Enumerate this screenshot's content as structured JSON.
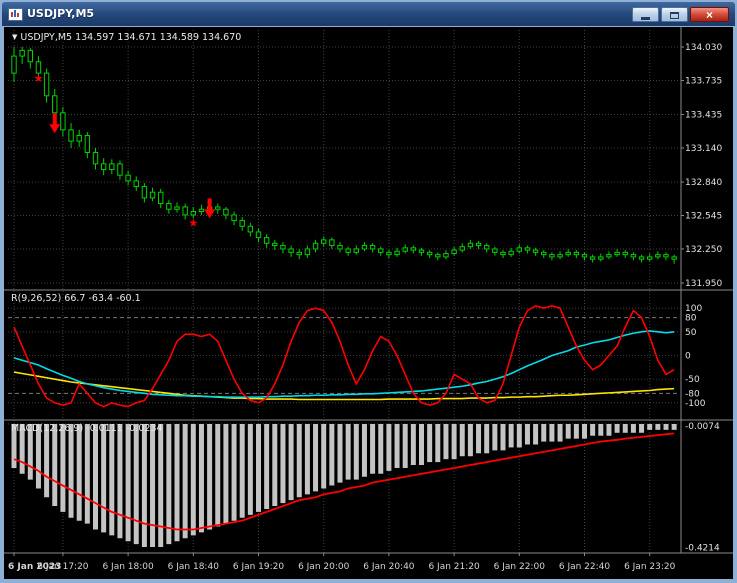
{
  "window": {
    "title": "USDJPY,M5",
    "close_glyph": "×"
  },
  "chart_header": {
    "dropdown_icon": "▼",
    "text": "USDJPY,M5 134.597 134.671 134.589 134.670"
  },
  "colors": {
    "background": "#000000",
    "window_border": "#8fafd4",
    "bull_candle": "#00d200",
    "grid": "#3f3f3f",
    "separator": "#8a8a8a",
    "scale_text": "#e0e0e0",
    "macd_hist": "#c4c4c4",
    "macd_signal": "#ff0000",
    "signal_marks": "#ff0000"
  },
  "chart_data": {
    "type": "candlestick",
    "symbol": "USDJPY",
    "timeframe": "M5",
    "star_glyph": "★",
    "price_axis": {
      "min": 131.95,
      "max": 134.03,
      "labels": [
        "134.030",
        "133.735",
        "133.435",
        "133.140",
        "132.840",
        "132.545",
        "132.250",
        "131.950"
      ]
    },
    "time_axis": {
      "labels": [
        {
          "text": "6 Jan 2023",
          "index": 0
        },
        {
          "text": "6 Jan 17:20",
          "index": 6
        },
        {
          "text": "6 Jan 18:00",
          "index": 14
        },
        {
          "text": "6 Jan 18:40",
          "index": 22
        },
        {
          "text": "6 Jan 19:20",
          "index": 30
        },
        {
          "text": "6 Jan 20:00",
          "index": 38
        },
        {
          "text": "6 Jan 20:40",
          "index": 46
        },
        {
          "text": "6 Jan 21:20",
          "index": 54
        },
        {
          "text": "6 Jan 22:00",
          "index": 62
        },
        {
          "text": "6 Jan 22:40",
          "index": 70
        },
        {
          "text": "6 Jan 23:20",
          "index": 78
        }
      ]
    },
    "candles": [
      [
        133.8,
        134.03,
        133.72,
        133.95
      ],
      [
        133.95,
        134.03,
        133.88,
        134.0
      ],
      [
        134.0,
        134.02,
        133.84,
        133.9
      ],
      [
        133.9,
        133.95,
        133.74,
        133.8
      ],
      [
        133.8,
        133.84,
        133.54,
        133.6
      ],
      [
        133.6,
        133.66,
        133.38,
        133.45
      ],
      [
        133.45,
        133.5,
        133.24,
        133.3
      ],
      [
        133.3,
        133.36,
        133.14,
        133.2
      ],
      [
        133.2,
        133.3,
        133.15,
        133.25
      ],
      [
        133.25,
        133.28,
        133.05,
        133.1
      ],
      [
        133.1,
        133.14,
        132.95,
        133.0
      ],
      [
        133.0,
        133.05,
        132.9,
        132.95
      ],
      [
        132.95,
        133.04,
        132.91,
        133.0
      ],
      [
        133.0,
        133.03,
        132.86,
        132.9
      ],
      [
        132.9,
        132.94,
        132.81,
        132.85
      ],
      [
        132.85,
        132.89,
        132.76,
        132.8
      ],
      [
        132.8,
        132.83,
        132.66,
        132.7
      ],
      [
        132.7,
        132.79,
        132.67,
        132.75
      ],
      [
        132.75,
        132.78,
        132.61,
        132.65
      ],
      [
        132.65,
        132.68,
        132.56,
        132.6
      ],
      [
        132.6,
        132.66,
        132.57,
        132.62
      ],
      [
        132.62,
        132.65,
        132.51,
        132.55
      ],
      [
        132.55,
        132.62,
        132.52,
        132.58
      ],
      [
        132.58,
        132.64,
        132.55,
        132.6
      ],
      [
        132.6,
        132.66,
        132.57,
        132.62
      ],
      [
        132.62,
        132.65,
        132.56,
        132.6
      ],
      [
        132.6,
        132.62,
        132.51,
        132.55
      ],
      [
        132.55,
        132.58,
        132.46,
        132.5
      ],
      [
        132.5,
        132.53,
        132.41,
        132.45
      ],
      [
        132.45,
        132.48,
        132.36,
        132.4
      ],
      [
        132.4,
        132.43,
        132.31,
        132.35
      ],
      [
        132.35,
        132.38,
        132.26,
        132.3
      ],
      [
        132.3,
        132.33,
        132.24,
        132.28
      ],
      [
        132.28,
        132.31,
        132.21,
        132.25
      ],
      [
        132.25,
        132.28,
        132.18,
        132.22
      ],
      [
        132.22,
        132.25,
        132.16,
        132.2
      ],
      [
        132.2,
        132.28,
        132.17,
        132.25
      ],
      [
        132.25,
        132.33,
        132.22,
        132.3
      ],
      [
        132.3,
        132.36,
        132.27,
        132.33
      ],
      [
        132.33,
        132.35,
        132.25,
        132.28
      ],
      [
        132.28,
        132.31,
        132.22,
        132.25
      ],
      [
        132.25,
        132.27,
        132.19,
        132.22
      ],
      [
        132.22,
        132.28,
        132.2,
        132.25
      ],
      [
        132.25,
        132.31,
        132.23,
        132.28
      ],
      [
        132.28,
        132.3,
        132.22,
        132.25
      ],
      [
        132.25,
        132.27,
        132.19,
        132.22
      ],
      [
        132.22,
        132.24,
        132.17,
        132.2
      ],
      [
        132.2,
        132.26,
        132.18,
        132.23
      ],
      [
        132.23,
        132.29,
        132.21,
        132.26
      ],
      [
        132.26,
        132.28,
        132.21,
        132.24
      ],
      [
        132.24,
        132.26,
        132.19,
        132.22
      ],
      [
        132.22,
        132.24,
        132.17,
        132.2
      ],
      [
        132.2,
        132.22,
        132.15,
        132.18
      ],
      [
        132.18,
        132.24,
        132.16,
        132.21
      ],
      [
        132.21,
        132.27,
        132.19,
        132.24
      ],
      [
        132.24,
        132.3,
        132.22,
        132.27
      ],
      [
        132.27,
        132.33,
        132.25,
        132.3
      ],
      [
        132.3,
        132.32,
        132.25,
        132.28
      ],
      [
        132.28,
        132.3,
        132.22,
        132.25
      ],
      [
        132.25,
        132.27,
        132.19,
        132.22
      ],
      [
        132.22,
        132.24,
        132.17,
        132.2
      ],
      [
        132.2,
        132.26,
        132.18,
        132.23
      ],
      [
        132.23,
        132.29,
        132.21,
        132.26
      ],
      [
        132.26,
        132.28,
        132.21,
        132.24
      ],
      [
        132.24,
        132.26,
        132.19,
        132.22
      ],
      [
        132.22,
        132.24,
        132.17,
        132.2
      ],
      [
        132.2,
        132.22,
        132.15,
        132.18
      ],
      [
        132.18,
        132.23,
        132.16,
        132.2
      ],
      [
        132.2,
        132.25,
        132.18,
        132.22
      ],
      [
        132.22,
        132.24,
        132.17,
        132.2
      ],
      [
        132.2,
        132.22,
        132.15,
        132.18
      ],
      [
        132.18,
        132.2,
        132.13,
        132.16
      ],
      [
        132.16,
        132.21,
        132.14,
        132.18
      ],
      [
        132.18,
        132.23,
        132.16,
        132.2
      ],
      [
        132.2,
        132.25,
        132.18,
        132.22
      ],
      [
        132.22,
        132.24,
        132.17,
        132.2
      ],
      [
        132.2,
        132.22,
        132.15,
        132.18
      ],
      [
        132.18,
        132.2,
        132.13,
        132.16
      ],
      [
        132.16,
        132.21,
        132.14,
        132.18
      ],
      [
        132.18,
        132.23,
        132.16,
        132.2
      ],
      [
        132.2,
        132.22,
        132.15,
        132.18
      ],
      [
        132.18,
        132.2,
        132.12,
        132.16
      ]
    ],
    "signals": [
      {
        "type": "star",
        "index": 3,
        "price": 133.72
      },
      {
        "type": "arrow-down",
        "index": 5,
        "price": 133.27
      },
      {
        "type": "star",
        "index": 22,
        "price": 132.45
      },
      {
        "type": "arrow-down",
        "index": 24,
        "price": 132.52
      }
    ],
    "panels": {
      "oscillator": {
        "label": "R(9,26,52) 66.7 -63.4 -60.1",
        "axis_labels": [
          "100",
          "80",
          "50",
          "0",
          "-50",
          "-80",
          "-100"
        ],
        "series": [
          {
            "name": "fast",
            "color": "#ff0000",
            "values": [
              60,
              20,
              -20,
              -60,
              -90,
              -100,
              -105,
              -100,
              -60,
              -80,
              -100,
              -108,
              -100,
              -105,
              -108,
              -100,
              -95,
              -70,
              -40,
              -10,
              30,
              45,
              45,
              40,
              45,
              30,
              -10,
              -50,
              -80,
              -95,
              -100,
              -90,
              -60,
              -20,
              30,
              70,
              95,
              100,
              95,
              70,
              30,
              -20,
              -60,
              -30,
              10,
              40,
              30,
              0,
              -40,
              -80,
              -100,
              -105,
              -100,
              -80,
              -40,
              -50,
              -60,
              -90,
              -100,
              -95,
              -60,
              0,
              60,
              95,
              105,
              100,
              105,
              100,
              60,
              20,
              -10,
              -30,
              -20,
              0,
              20,
              60,
              95,
              80,
              40,
              -10,
              -40,
              -30
            ]
          },
          {
            "name": "mid",
            "color": "#00dde8",
            "values": [
              -5,
              -10,
              -15,
              -20,
              -28,
              -35,
              -42,
              -48,
              -55,
              -60,
              -64,
              -68,
              -71,
              -74,
              -76,
              -78,
              -80,
              -82,
              -83,
              -84,
              -85,
              -85,
              -86,
              -86,
              -87,
              -87,
              -88,
              -88,
              -88,
              -88,
              -88,
              -87,
              -87,
              -86,
              -86,
              -85,
              -85,
              -84,
              -84,
              -83,
              -83,
              -82,
              -82,
              -81,
              -81,
              -80,
              -79,
              -78,
              -77,
              -76,
              -75,
              -73,
              -71,
              -69,
              -67,
              -65,
              -62,
              -58,
              -55,
              -50,
              -45,
              -38,
              -30,
              -22,
              -15,
              -8,
              0,
              5,
              10,
              18,
              22,
              27,
              30,
              33,
              38,
              43,
              47,
              50,
              52,
              50,
              48,
              50
            ]
          },
          {
            "name": "slow",
            "color": "#ffe400",
            "values": [
              -35,
              -38,
              -41,
              -44,
              -47,
              -50,
              -53,
              -56,
              -58,
              -60,
              -62,
              -64,
              -66,
              -68,
              -70,
              -72,
              -74,
              -76,
              -78,
              -80,
              -82,
              -84,
              -85,
              -86,
              -87,
              -88,
              -89,
              -90,
              -90,
              -91,
              -91,
              -92,
              -92,
              -92,
              -92,
              -93,
              -93,
              -93,
              -93,
              -93,
              -93,
              -93,
              -93,
              -93,
              -93,
              -93,
              -92,
              -92,
              -92,
              -92,
              -92,
              -92,
              -91,
              -91,
              -91,
              -91,
              -90,
              -90,
              -90,
              -89,
              -89,
              -88,
              -88,
              -87,
              -87,
              -86,
              -85,
              -84,
              -84,
              -83,
              -82,
              -81,
              -80,
              -79,
              -78,
              -77,
              -76,
              -75,
              -74,
              -72,
              -71,
              -70
            ]
          }
        ]
      },
      "macd": {
        "label": "MACD(12,26,9) -0.0111 -0.0234",
        "axis_labels": [
          "-0.0074",
          "-0.4214"
        ],
        "histogram": [
          -0.15,
          -0.17,
          -0.19,
          -0.22,
          -0.25,
          -0.28,
          -0.3,
          -0.32,
          -0.33,
          -0.34,
          -0.36,
          -0.37,
          -0.38,
          -0.39,
          -0.4,
          -0.41,
          -0.42,
          -0.42,
          -0.42,
          -0.41,
          -0.4,
          -0.39,
          -0.38,
          -0.37,
          -0.36,
          -0.35,
          -0.34,
          -0.33,
          -0.32,
          -0.31,
          -0.3,
          -0.29,
          -0.28,
          -0.27,
          -0.26,
          -0.25,
          -0.24,
          -0.23,
          -0.22,
          -0.21,
          -0.2,
          -0.19,
          -0.19,
          -0.18,
          -0.17,
          -0.17,
          -0.16,
          -0.15,
          -0.15,
          -0.14,
          -0.14,
          -0.13,
          -0.13,
          -0.12,
          -0.12,
          -0.11,
          -0.11,
          -0.1,
          -0.1,
          -0.09,
          -0.09,
          -0.08,
          -0.08,
          -0.07,
          -0.07,
          -0.06,
          -0.06,
          -0.06,
          -0.05,
          -0.05,
          -0.05,
          -0.04,
          -0.04,
          -0.04,
          -0.03,
          -0.03,
          -0.03,
          -0.03,
          -0.02,
          -0.02,
          -0.02,
          -0.02
        ],
        "signal": [
          -0.12,
          -0.13,
          -0.145,
          -0.16,
          -0.18,
          -0.195,
          -0.21,
          -0.225,
          -0.24,
          -0.255,
          -0.27,
          -0.285,
          -0.3,
          -0.31,
          -0.32,
          -0.33,
          -0.34,
          -0.345,
          -0.35,
          -0.355,
          -0.36,
          -0.36,
          -0.36,
          -0.355,
          -0.35,
          -0.345,
          -0.34,
          -0.335,
          -0.33,
          -0.32,
          -0.31,
          -0.3,
          -0.29,
          -0.28,
          -0.27,
          -0.26,
          -0.255,
          -0.25,
          -0.24,
          -0.235,
          -0.23,
          -0.22,
          -0.215,
          -0.21,
          -0.2,
          -0.195,
          -0.19,
          -0.185,
          -0.18,
          -0.175,
          -0.17,
          -0.165,
          -0.16,
          -0.155,
          -0.15,
          -0.145,
          -0.14,
          -0.135,
          -0.13,
          -0.125,
          -0.12,
          -0.115,
          -0.11,
          -0.105,
          -0.1,
          -0.095,
          -0.09,
          -0.085,
          -0.08,
          -0.075,
          -0.07,
          -0.065,
          -0.06,
          -0.057,
          -0.054,
          -0.05,
          -0.047,
          -0.044,
          -0.041,
          -0.038,
          -0.035,
          -0.032
        ]
      }
    }
  }
}
